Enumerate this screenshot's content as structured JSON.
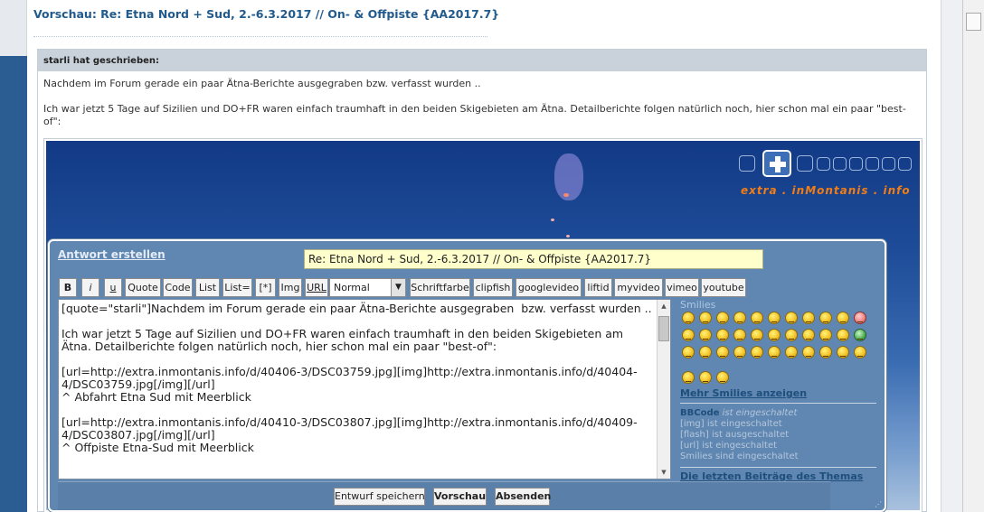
{
  "page": {
    "title": "Vorschau: Re: Etna Nord + Sud, 2.-6.3.2017 // On- & Offpiste {AA2017.7}"
  },
  "quote": {
    "author_line": "starli hat geschrieben:",
    "paragraph_1": "Nachdem im Forum gerade ein paar Ätna-Berichte ausgegraben bzw. verfasst wurden ..",
    "paragraph_2": "Ich war jetzt 5 Tage auf Sizilien und DO+FR waren einfach traumhaft in den beiden Skigebieten am Ätna. Detailberichte folgen natürlich noch, hier schon mal ein paar \"best-of\":"
  },
  "photo": {
    "logo_text": "extra . inMontanis . info"
  },
  "reply": {
    "title": "Antwort erstellen",
    "subject_value": "Re: Etna Nord + Sud, 2.-6.3.2017 // On- & Offpiste {AA2017.7}",
    "toolbar": {
      "bold": "B",
      "italic": "i",
      "underline": "u",
      "quote": "Quote",
      "code": "Code",
      "list": "List",
      "list_eq": "List=",
      "list_item": "[*]",
      "img": "Img",
      "url": "URL",
      "size_select": "Normal",
      "color": "Schriftfarbe",
      "clipfish": "clipfish",
      "googlevideo": "googlevideo",
      "liftid": "liftid",
      "myvideo": "myvideo",
      "vimeo": "vimeo",
      "youtube": "youtube"
    },
    "message": "[quote=\"starli\"]Nachdem im Forum gerade ein paar Ätna-Berichte ausgegraben  bzw. verfasst wurden ..\n\nIch war jetzt 5 Tage auf Sizilien und DO+FR waren einfach traumhaft in den beiden Skigebieten am Ätna. Detailberichte folgen natürlich noch, hier schon mal ein paar \"best-of\":\n\n[url=http://extra.inmontanis.info/d/40406-3/DSC03759.jpg][img]http://extra.inmontanis.info/d/40404-4/DSC03759.jpg[/img][/url]\n^ Abfahrt Etna Sud mit Meerblick\n\n[url=http://extra.inmontanis.info/d/40410-3/DSC03807.jpg][img]http://extra.inmontanis.info/d/40409-4/DSC03807.jpg[/img][/url]\n^ Offpiste Etna-Sud mit Meerblick",
    "smilies": {
      "title": "Smilies",
      "more_link": "Mehr Smilies anzeigen"
    },
    "status": {
      "bbcode_label": "BBCode",
      "bbcode_state": "ist eingeschaltet",
      "img_line": "[img] ist eingeschaltet",
      "flash_line": "[flash] ist ausgeschaltet",
      "url_line": "[url] ist eingeschaltet",
      "smilies_line": "Smilies sind eingeschaltet"
    },
    "latest_link": "Die letzten Beiträge des Themas",
    "buttons": {
      "save_draft": "Entwurf speichern",
      "preview": "Vorschau",
      "submit": "Absenden"
    }
  }
}
